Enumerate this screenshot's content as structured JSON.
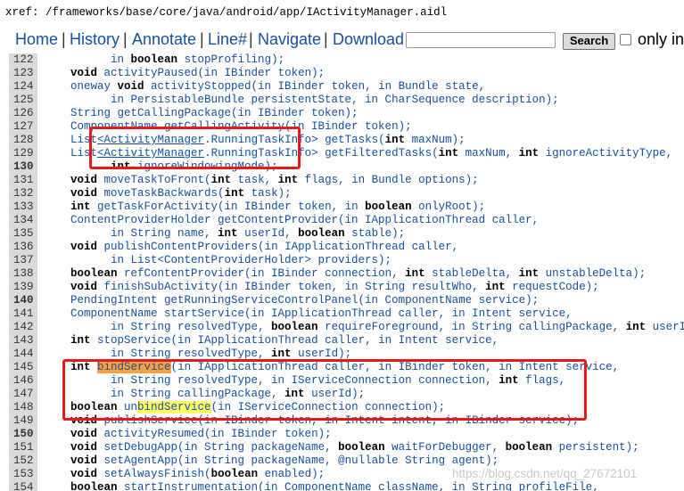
{
  "xref_path": "xref: /frameworks/base/core/java/android/app/IActivityManager.aidl",
  "nav": {
    "links": [
      "Home",
      "History",
      "Annotate",
      "Line#",
      "Navigate",
      "Download"
    ],
    "separator": "|",
    "search_value": "",
    "search_button": "Search",
    "only_in_label": "only in"
  },
  "watermark": "https://blog.csdn.net/qq_27672101",
  "code_lines": [
    {
      "n": "122",
      "bold_ln": false,
      "segs": [
        {
          "t": "          in "
        },
        {
          "t": "boolean",
          "c": "kw"
        },
        {
          "t": " stopProfiling);"
        }
      ]
    },
    {
      "n": "123",
      "bold_ln": false,
      "segs": [
        {
          "t": "    "
        },
        {
          "t": "void",
          "c": "kw"
        },
        {
          "t": " activityPaused(in IBinder token);"
        }
      ]
    },
    {
      "n": "124",
      "bold_ln": false,
      "segs": [
        {
          "t": "    oneway "
        },
        {
          "t": "void",
          "c": "kw"
        },
        {
          "t": " activityStopped(in IBinder token, in Bundle state,"
        }
      ]
    },
    {
      "n": "125",
      "bold_ln": false,
      "segs": [
        {
          "t": "          in PersistableBundle persistentState, in CharSequence description);"
        }
      ]
    },
    {
      "n": "126",
      "bold_ln": false,
      "segs": [
        {
          "t": "    String getCallingPackage(in IBinder token);"
        }
      ]
    },
    {
      "n": "127",
      "bold_ln": false,
      "segs": [
        {
          "t": "    ComponentName getCallingActivity(in IBinder token);"
        }
      ]
    },
    {
      "n": "128",
      "bold_ln": false,
      "segs": [
        {
          "t": "    List"
        },
        {
          "t": "<",
          "c": "lt"
        },
        {
          "t": "ActivityManager",
          "c": "lt"
        },
        {
          "t": ".RunningTaskInfo> getTasks("
        },
        {
          "t": "int",
          "c": "kw"
        },
        {
          "t": " maxNum);"
        }
      ]
    },
    {
      "n": "129",
      "bold_ln": false,
      "segs": [
        {
          "t": "    List"
        },
        {
          "t": "<",
          "c": "lt"
        },
        {
          "t": "ActivityManager",
          "c": "lt"
        },
        {
          "t": ".RunningTaskInfo> getFilteredTasks("
        },
        {
          "t": "int",
          "c": "kw"
        },
        {
          "t": " maxNum, "
        },
        {
          "t": "int",
          "c": "kw"
        },
        {
          "t": " ignoreActivityType,"
        }
      ]
    },
    {
      "n": "130",
      "bold_ln": true,
      "segs": [
        {
          "t": "          "
        },
        {
          "t": "int",
          "c": "kw"
        },
        {
          "t": " ignoreWindowingMode);"
        }
      ]
    },
    {
      "n": "131",
      "bold_ln": false,
      "segs": [
        {
          "t": "    "
        },
        {
          "t": "void",
          "c": "kw"
        },
        {
          "t": " moveTaskToFront("
        },
        {
          "t": "int",
          "c": "kw"
        },
        {
          "t": " task, "
        },
        {
          "t": "int",
          "c": "kw"
        },
        {
          "t": " flags, in Bundle options);"
        }
      ]
    },
    {
      "n": "132",
      "bold_ln": false,
      "segs": [
        {
          "t": "    "
        },
        {
          "t": "void",
          "c": "kw"
        },
        {
          "t": " moveTaskBackwards("
        },
        {
          "t": "int",
          "c": "kw"
        },
        {
          "t": " task);"
        }
      ]
    },
    {
      "n": "133",
      "bold_ln": false,
      "segs": [
        {
          "t": "    "
        },
        {
          "t": "int",
          "c": "kw"
        },
        {
          "t": " getTaskForActivity(in IBinder token, in "
        },
        {
          "t": "boolean",
          "c": "kw"
        },
        {
          "t": " onlyRoot);"
        }
      ]
    },
    {
      "n": "134",
      "bold_ln": false,
      "segs": [
        {
          "t": "    ContentProviderHolder getContentProvider(in IApplicationThread caller,"
        }
      ]
    },
    {
      "n": "135",
      "bold_ln": false,
      "segs": [
        {
          "t": "          in String name, "
        },
        {
          "t": "int",
          "c": "kw"
        },
        {
          "t": " userId, "
        },
        {
          "t": "boolean",
          "c": "kw"
        },
        {
          "t": " stable);"
        }
      ]
    },
    {
      "n": "136",
      "bold_ln": false,
      "segs": [
        {
          "t": "    "
        },
        {
          "t": "void",
          "c": "kw"
        },
        {
          "t": " publishContentProviders(in IApplicationThread caller,"
        }
      ]
    },
    {
      "n": "137",
      "bold_ln": false,
      "segs": [
        {
          "t": "          in List<ContentProviderHolder> providers);"
        }
      ]
    },
    {
      "n": "138",
      "bold_ln": false,
      "segs": [
        {
          "t": "    "
        },
        {
          "t": "boolean",
          "c": "kw"
        },
        {
          "t": " refContentProvider(in IBinder connection, "
        },
        {
          "t": "int",
          "c": "kw"
        },
        {
          "t": " stableDelta, "
        },
        {
          "t": "int",
          "c": "kw"
        },
        {
          "t": " unstableDelta);"
        }
      ]
    },
    {
      "n": "139",
      "bold_ln": false,
      "segs": [
        {
          "t": "    "
        },
        {
          "t": "void",
          "c": "kw"
        },
        {
          "t": " finishSubActivity(in IBinder token, in String resultWho, "
        },
        {
          "t": "int",
          "c": "kw"
        },
        {
          "t": " requestCode);"
        }
      ]
    },
    {
      "n": "140",
      "bold_ln": true,
      "segs": [
        {
          "t": "    PendingIntent getRunningServiceControlPanel(in ComponentName service);"
        }
      ]
    },
    {
      "n": "141",
      "bold_ln": false,
      "segs": [
        {
          "t": "    ComponentName startService(in IApplicationThread caller, in Intent service,"
        }
      ]
    },
    {
      "n": "142",
      "bold_ln": false,
      "segs": [
        {
          "t": "          in String resolvedType, "
        },
        {
          "t": "boolean",
          "c": "kw"
        },
        {
          "t": " requireForeground, in String callingPackage, "
        },
        {
          "t": "int",
          "c": "kw"
        },
        {
          "t": " userId);"
        }
      ]
    },
    {
      "n": "143",
      "bold_ln": false,
      "segs": [
        {
          "t": "    "
        },
        {
          "t": "int",
          "c": "kw"
        },
        {
          "t": " stopService(in IApplicationThread caller, in Intent service,"
        }
      ]
    },
    {
      "n": "144",
      "bold_ln": false,
      "segs": [
        {
          "t": "          in String resolvedType, "
        },
        {
          "t": "int",
          "c": "kw"
        },
        {
          "t": " userId);"
        }
      ]
    },
    {
      "n": "145",
      "bold_ln": false,
      "segs": [
        {
          "t": "    "
        },
        {
          "t": "int",
          "c": "kw"
        },
        {
          "t": " "
        },
        {
          "t": "bindService",
          "c": "hl1"
        },
        {
          "t": "(in IApplicationThread caller, in IBinder token, in Intent service,"
        }
      ]
    },
    {
      "n": "146",
      "bold_ln": false,
      "segs": [
        {
          "t": "          in String resolvedType, in IServiceConnection connection, "
        },
        {
          "t": "int",
          "c": "kw"
        },
        {
          "t": " flags,"
        }
      ]
    },
    {
      "n": "147",
      "bold_ln": false,
      "segs": [
        {
          "t": "          in String callingPackage, "
        },
        {
          "t": "int",
          "c": "kw"
        },
        {
          "t": " userId);"
        }
      ]
    },
    {
      "n": "148",
      "bold_ln": false,
      "segs": [
        {
          "t": "    "
        },
        {
          "t": "boolean",
          "c": "kw"
        },
        {
          "t": " un"
        },
        {
          "t": "bindService",
          "c": "hl2"
        },
        {
          "t": "(in IServiceConnection connection);"
        }
      ]
    },
    {
      "n": "149",
      "bold_ln": false,
      "segs": [
        {
          "t": "    "
        },
        {
          "t": "void",
          "c": "kw"
        },
        {
          "t": " publishService(in IBinder token, in Intent intent, in IBinder service);"
        }
      ]
    },
    {
      "n": "150",
      "bold_ln": true,
      "segs": [
        {
          "t": "    "
        },
        {
          "t": "void",
          "c": "kw"
        },
        {
          "t": " activityResumed(in IBinder token);"
        }
      ]
    },
    {
      "n": "151",
      "bold_ln": false,
      "segs": [
        {
          "t": "    "
        },
        {
          "t": "void",
          "c": "kw"
        },
        {
          "t": " setDebugApp(in String packageName, "
        },
        {
          "t": "boolean",
          "c": "kw"
        },
        {
          "t": " waitForDebugger, "
        },
        {
          "t": "boolean",
          "c": "kw"
        },
        {
          "t": " persistent);"
        }
      ]
    },
    {
      "n": "152",
      "bold_ln": false,
      "segs": [
        {
          "t": "    "
        },
        {
          "t": "void",
          "c": "kw"
        },
        {
          "t": " setAgentApp(in String packageName, @nullable String agent);"
        }
      ]
    },
    {
      "n": "153",
      "bold_ln": false,
      "segs": [
        {
          "t": "    "
        },
        {
          "t": "void",
          "c": "kw"
        },
        {
          "t": " setAlwaysFinish("
        },
        {
          "t": "boolean",
          "c": "kw"
        },
        {
          "t": " enabled);"
        }
      ]
    },
    {
      "n": "154",
      "bold_ln": false,
      "segs": [
        {
          "t": "    "
        },
        {
          "t": "boolean",
          "c": "kw"
        },
        {
          "t": " startInstrumentation(in ComponentName className, in String profileFile,"
        }
      ]
    }
  ]
}
